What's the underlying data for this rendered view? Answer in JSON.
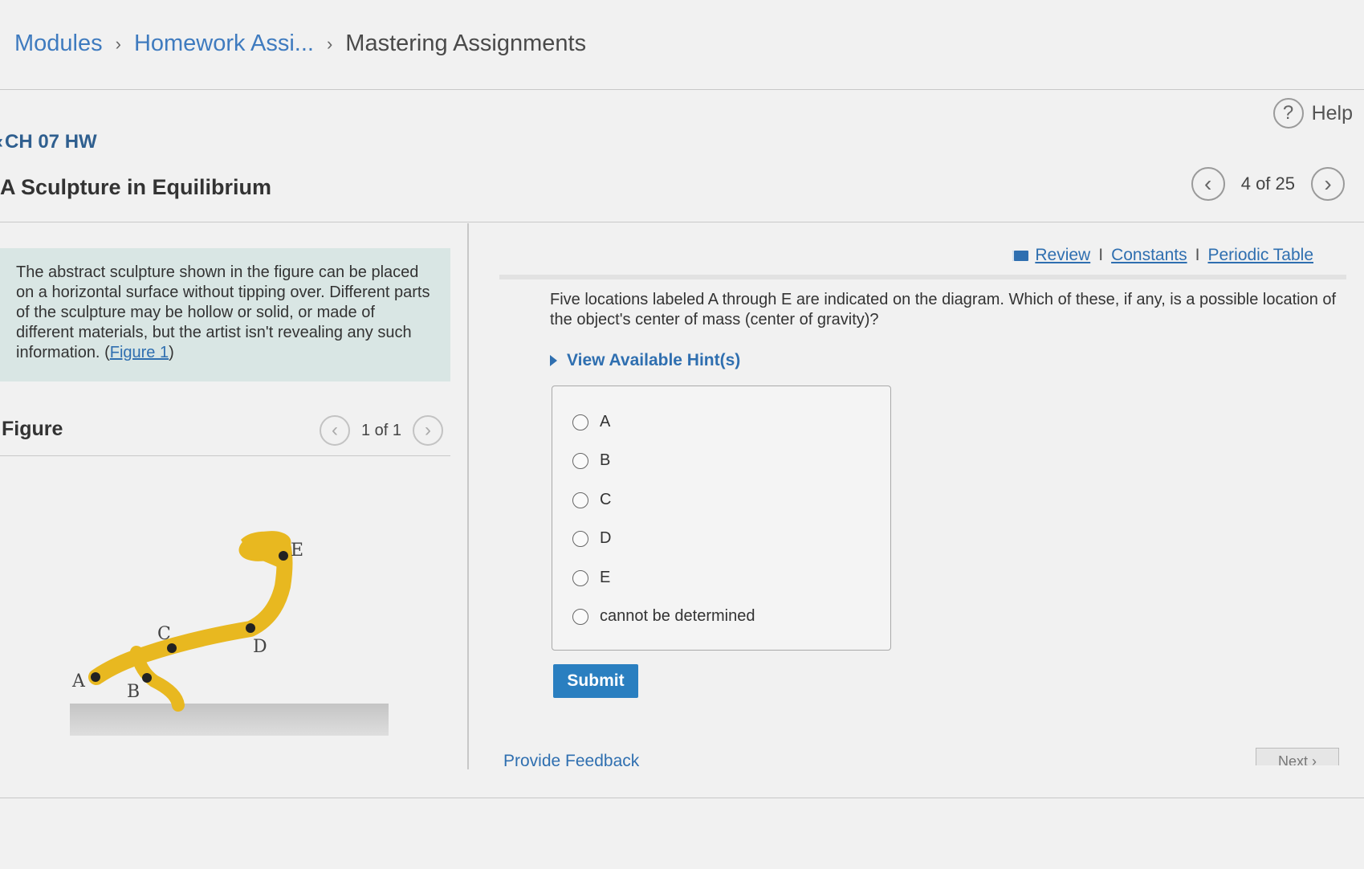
{
  "breadcrumb": {
    "modules": "Modules",
    "homework": "Homework Assi...",
    "current": "Mastering Assignments",
    "separator": "›"
  },
  "help": {
    "label": "Help",
    "icon": "question-circle-icon"
  },
  "assignment": {
    "title": "CH 07 HW",
    "back_icon": "chevron-left-icon"
  },
  "problem": {
    "title": "A Sculpture in Equilibrium"
  },
  "pager": {
    "text": "4 of 25",
    "prev": "‹",
    "next": "›"
  },
  "intro": {
    "text": "The abstract sculpture shown in the figure can be placed on a horizontal surface without tipping over. Different parts of the sculpture may be hollow or solid, or made of different materials, but the artist isn't revealing any such information. ",
    "open_paren": "(",
    "figure_link": "Figure 1",
    "close_paren": ")"
  },
  "figure": {
    "label": "Figure",
    "pager_text": "1 of 1",
    "point_labels": [
      "A",
      "B",
      "C",
      "D",
      "E"
    ]
  },
  "resources": {
    "review": "Review",
    "constants": "Constants",
    "periodic_table": "Periodic Table",
    "divider": "I",
    "review_icon": "book-icon"
  },
  "question": {
    "text": "Five locations labeled A through E are indicated on the diagram. Which of these, if any, is a possible location of the object's center of mass (center of gravity)?",
    "hints_label": "View Available Hint(s)"
  },
  "options": [
    "A",
    "B",
    "C",
    "D",
    "E",
    "cannot be determined"
  ],
  "submit_label": "Submit",
  "feedback_label": "Provide Feedback",
  "next_label": "Next ›",
  "colors": {
    "accent": "#2a7fc0",
    "link": "#2f6fb0",
    "sculpture": "#e8b820",
    "intro_bg": "#d9e6e4"
  }
}
